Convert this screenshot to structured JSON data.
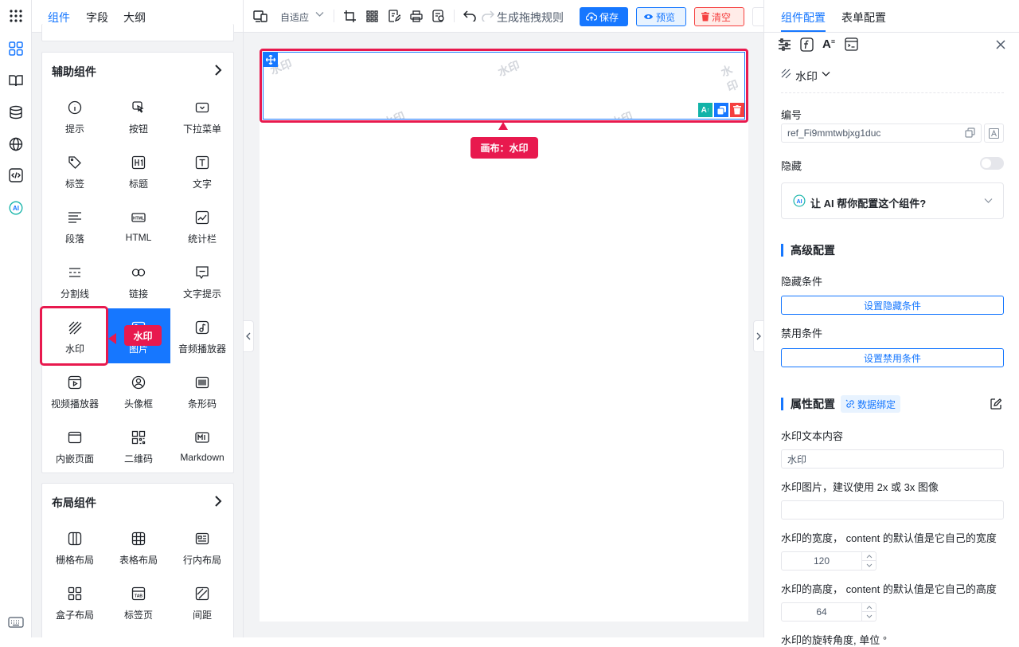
{
  "left_tabs": [
    "组件",
    "字段",
    "大纲"
  ],
  "aux_card": {
    "title": "辅助组件",
    "items": [
      {
        "label": "提示",
        "icon": "info-icon"
      },
      {
        "label": "按钮",
        "icon": "button-icon"
      },
      {
        "label": "下拉菜单",
        "icon": "dropdown-icon"
      },
      {
        "label": "标签",
        "icon": "tag-icon"
      },
      {
        "label": "标题",
        "icon": "heading-icon"
      },
      {
        "label": "文字",
        "icon": "text-icon"
      },
      {
        "label": "段落",
        "icon": "paragraph-icon"
      },
      {
        "label": "HTML",
        "icon": "html-icon"
      },
      {
        "label": "统计栏",
        "icon": "statistic-icon"
      },
      {
        "label": "分割线",
        "icon": "divider-icon"
      },
      {
        "label": "链接",
        "icon": "link-icon"
      },
      {
        "label": "文字提示",
        "icon": "tooltip-icon"
      },
      {
        "label": "水印",
        "icon": "watermark-icon"
      },
      {
        "label": "图片",
        "icon": "image-icon"
      },
      {
        "label": "音频播放器",
        "icon": "audio-icon"
      },
      {
        "label": "视频播放器",
        "icon": "video-icon"
      },
      {
        "label": "头像框",
        "icon": "avatar-icon"
      },
      {
        "label": "条形码",
        "icon": "barcode-icon"
      },
      {
        "label": "内嵌页面",
        "icon": "iframe-icon"
      },
      {
        "label": "二维码",
        "icon": "qrcode-icon"
      },
      {
        "label": "Markdown",
        "icon": "markdown-icon"
      }
    ]
  },
  "layout_card": {
    "title": "布局组件",
    "items": [
      {
        "label": "栅格布局",
        "icon": "grid-icon"
      },
      {
        "label": "表格布局",
        "icon": "table-icon"
      },
      {
        "label": "行内布局",
        "icon": "inline-icon"
      },
      {
        "label": "盒子布局",
        "icon": "box-icon"
      },
      {
        "label": "标签页",
        "icon": "tabs-icon"
      },
      {
        "label": "间距",
        "icon": "space-icon"
      }
    ]
  },
  "toolbar": {
    "device": "自适应",
    "rule_label": "生成拖拽规则",
    "save": "保存",
    "preview": "预览",
    "clear": "清空"
  },
  "canvas": {
    "watermark_text": "水印",
    "callout": "画布：水印"
  },
  "left_callout": "水印",
  "right": {
    "tabs": [
      "组件配置",
      "表单配置"
    ],
    "component_name": "水印",
    "id_label": "编号",
    "id_value": "ref_Fi9mmtwbjxg1duc",
    "hidden_label": "隐藏",
    "ai_prompt": "让 AI 帮你配置这个组件?",
    "advanced_title": "高级配置",
    "hide_cond_label": "隐藏条件",
    "hide_cond_btn": "设置隐藏条件",
    "disable_cond_label": "禁用条件",
    "disable_cond_btn": "设置禁用条件",
    "props_title": "属性配置",
    "data_binding": "数据绑定",
    "wm_content_label": "水印文本内容",
    "wm_content_value": "水印",
    "wm_image_label": "水印图片，建议使用 2x 或 3x 图像",
    "wm_image_value": "",
    "wm_width_label": "水印的宽度， content 的默认值是它自己的宽度",
    "wm_width_value": "120",
    "wm_height_label": "水印的高度， content 的默认值是它自己的高度",
    "wm_height_value": "64",
    "wm_rotate_label": "水印的旋转角度, 单位 °"
  },
  "colors": {
    "accent": "#1677ff",
    "highlight": "#e8194e",
    "danger": "#f53f3f"
  }
}
